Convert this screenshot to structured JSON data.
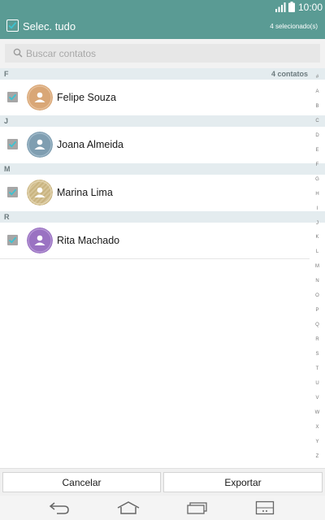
{
  "status": {
    "time": "10:00",
    "signal_icon": "signal-icon",
    "battery_icon": "battery-icon"
  },
  "header": {
    "select_all_label": "Selec. tudo",
    "selected_count": "4 selecionado(s)"
  },
  "search": {
    "placeholder": "Buscar contatos",
    "value": ""
  },
  "contacts_count": "4 contatos",
  "sections": [
    {
      "letter": "F",
      "contacts": [
        {
          "name": "Felipe Souza",
          "checked": true,
          "avatar_color": "#d9a777"
        }
      ]
    },
    {
      "letter": "J",
      "contacts": [
        {
          "name": "Joana Almeida",
          "checked": true,
          "avatar_color": "#7f9eb1"
        }
      ]
    },
    {
      "letter": "M",
      "contacts": [
        {
          "name": "Marina Lima",
          "checked": true,
          "avatar_color": "#d6c497"
        }
      ]
    },
    {
      "letter": "R",
      "contacts": [
        {
          "name": "Rita Machado",
          "checked": true,
          "avatar_color": "#9a72c2"
        }
      ]
    }
  ],
  "index_letters": [
    "#",
    "A",
    "B",
    "C",
    "D",
    "E",
    "F",
    "G",
    "H",
    "I",
    "J",
    "K",
    "L",
    "M",
    "N",
    "O",
    "P",
    "Q",
    "R",
    "S",
    "T",
    "U",
    "V",
    "W",
    "X",
    "Y",
    "Z"
  ],
  "actions": {
    "cancel_label": "Cancelar",
    "export_label": "Exportar"
  },
  "colors": {
    "accent": "#5a9b94",
    "check": "#3cc3d2",
    "section_bg": "#e4ecef"
  },
  "nav_icons": [
    "back-icon",
    "home-icon",
    "recent-apps-icon",
    "menu-icon"
  ]
}
